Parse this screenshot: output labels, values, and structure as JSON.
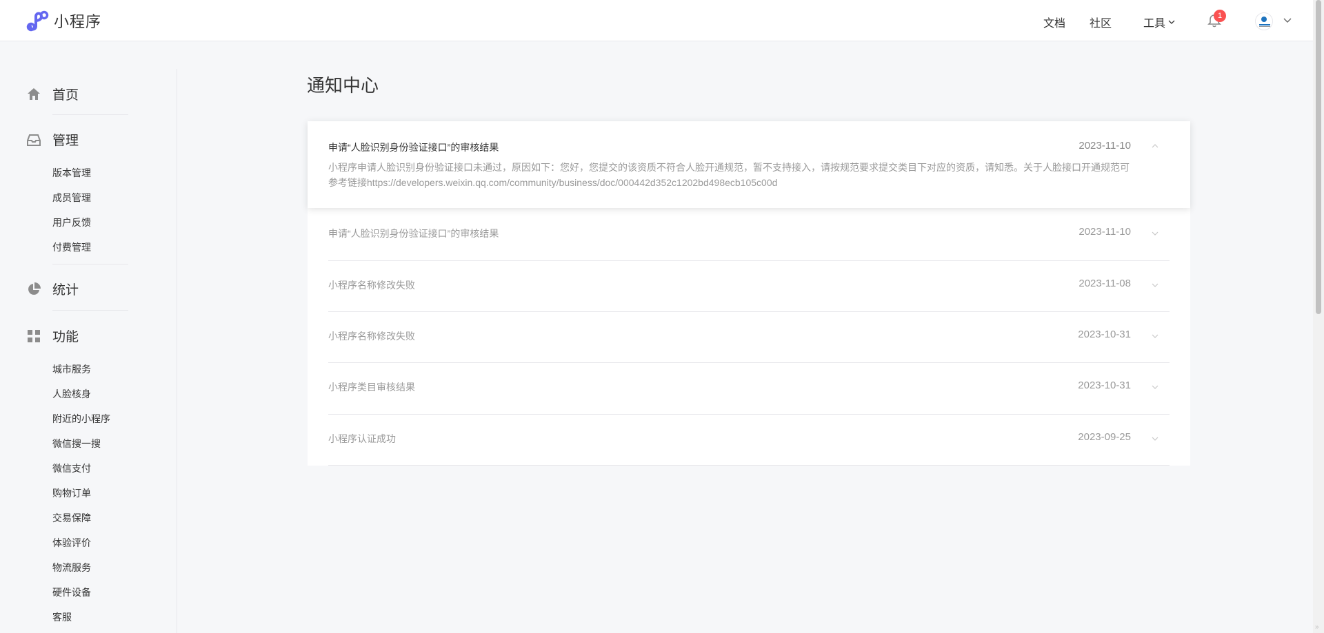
{
  "header": {
    "app_name": "小程序",
    "nav": {
      "docs": "文档",
      "community": "社区",
      "tools": "工具"
    },
    "notification_count": "1",
    "icons": {
      "logo": "mini-program-logo",
      "bell": "bell-icon",
      "tools_chevron": "chevron-down-icon",
      "account_chevron": "chevron-down-icon"
    }
  },
  "sidebar": {
    "home": {
      "label": "首页",
      "icon": "home-icon"
    },
    "manage": {
      "label": "管理",
      "icon": "inbox-icon",
      "items": [
        "版本管理",
        "成员管理",
        "用户反馈",
        "付费管理"
      ]
    },
    "stats": {
      "label": "统计",
      "icon": "pie-chart-icon"
    },
    "features": {
      "label": "功能",
      "icon": "grid-icon",
      "items": [
        "城市服务",
        "人脸核身",
        "附近的小程序",
        "微信搜一搜",
        "微信支付",
        "购物订单",
        "交易保障",
        "体验评价",
        "物流服务",
        "硬件设备",
        "客服"
      ]
    }
  },
  "main": {
    "title": "通知中心",
    "expanded": {
      "title": "申请“人脸识别身份验证接口”的审核结果",
      "date": "2023-11-10",
      "body": "小程序申请人脸识别身份验证接口未通过，原因如下：您好，您提交的该资质不符合人脸开通规范，暂不支持接入，请按规范要求提交类目下对应的资质，请知悉。关于人脸接口开通规范可参考链接https://developers.weixin.qq.com/community/business/doc/000442d352c1202bd498ecb105c00d"
    },
    "notices": [
      {
        "title": "申请“人脸识别身份验证接口”的审核结果",
        "date": "2023-11-10"
      },
      {
        "title": "小程序名称修改失败",
        "date": "2023-11-08"
      },
      {
        "title": "小程序名称修改失败",
        "date": "2023-10-31"
      },
      {
        "title": "小程序类目审核结果",
        "date": "2023-10-31"
      },
      {
        "title": "小程序认证成功",
        "date": "2023-09-25"
      }
    ]
  },
  "colors": {
    "accent": "#6467f0",
    "badge": "#fa5151",
    "text": "#353535",
    "muted": "#9a9a9a",
    "border": "#e7e7eb",
    "bg": "#f6f7f9"
  }
}
